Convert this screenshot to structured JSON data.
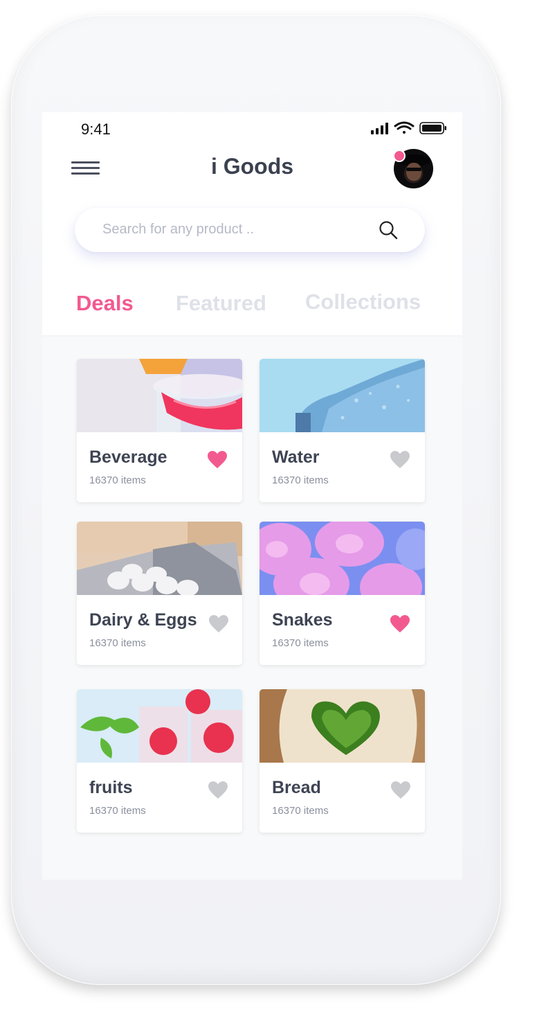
{
  "status_bar": {
    "time": "9:41"
  },
  "header": {
    "title": "i Goods"
  },
  "search": {
    "placeholder": "Search for any product .."
  },
  "tabs": [
    {
      "label": "Deals",
      "active": true
    },
    {
      "label": "Featured",
      "active": false
    },
    {
      "label": "Collections",
      "active": false
    }
  ],
  "colors": {
    "accent": "#f25a8f",
    "inactive_tab": "#dfe1e8",
    "heart_off": "#c9cacd",
    "title": "#3b4150"
  },
  "cards": [
    {
      "name": "Beverage",
      "count": "16370 items",
      "liked": true,
      "icon": "heart-icon"
    },
    {
      "name": "Water",
      "count": "16370 items",
      "liked": false,
      "icon": "heart-icon"
    },
    {
      "name": "Dairy & Eggs",
      "count": "16370 items",
      "liked": false,
      "icon": "heart-icon"
    },
    {
      "name": "Snakes",
      "count": "16370 items",
      "liked": true,
      "icon": "heart-icon"
    },
    {
      "name": "fruits",
      "count": "16370 items",
      "liked": false,
      "icon": "heart-icon"
    },
    {
      "name": "Bread",
      "count": "16370 items",
      "liked": false,
      "icon": "heart-icon"
    }
  ]
}
